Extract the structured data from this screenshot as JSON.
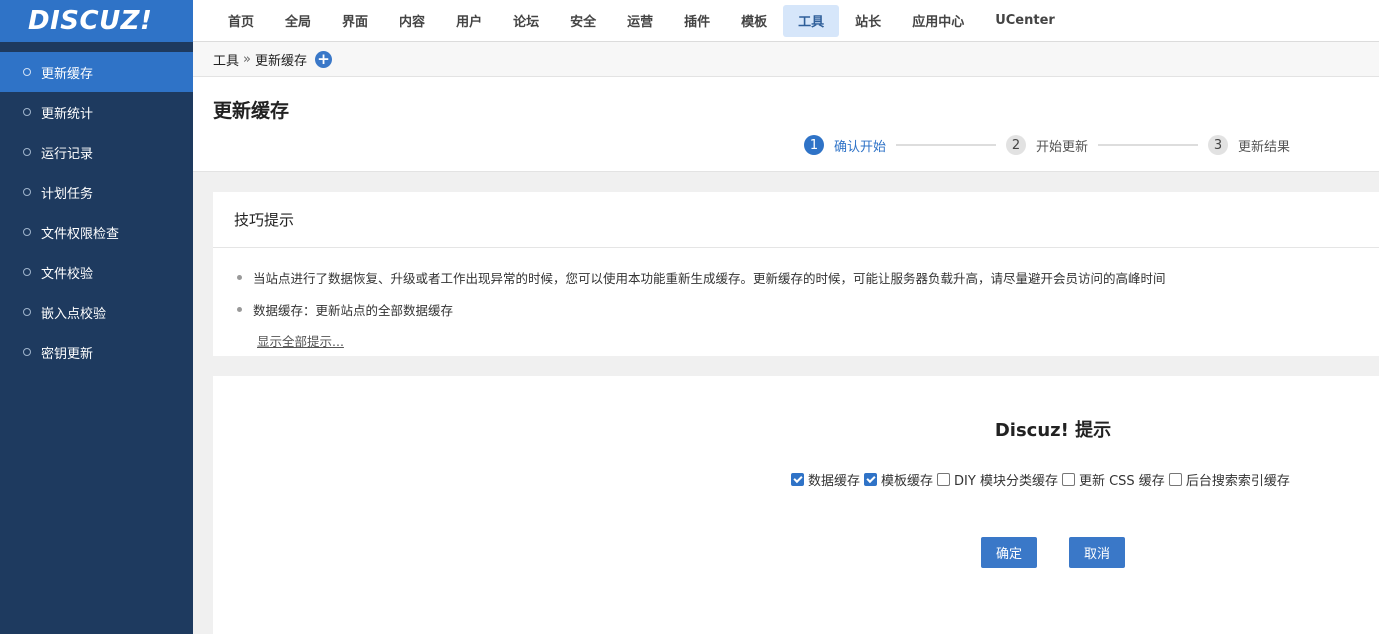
{
  "logo": "DISCUZ!",
  "sidebar": {
    "items": [
      {
        "label": "更新缓存"
      },
      {
        "label": "更新统计"
      },
      {
        "label": "运行记录"
      },
      {
        "label": "计划任务"
      },
      {
        "label": "文件权限检查"
      },
      {
        "label": "文件校验"
      },
      {
        "label": "嵌入点校验"
      },
      {
        "label": "密钥更新"
      }
    ]
  },
  "nav": {
    "items": [
      {
        "label": "首页"
      },
      {
        "label": "全局"
      },
      {
        "label": "界面"
      },
      {
        "label": "内容"
      },
      {
        "label": "用户"
      },
      {
        "label": "论坛"
      },
      {
        "label": "安全"
      },
      {
        "label": "运营"
      },
      {
        "label": "插件"
      },
      {
        "label": "模板"
      },
      {
        "label": "工具"
      },
      {
        "label": "站长"
      },
      {
        "label": "应用中心"
      },
      {
        "label": "UCenter"
      }
    ]
  },
  "breadcrumb": {
    "root": "工具",
    "sep": "»",
    "current": "更新缓存",
    "add_icon": "+"
  },
  "page": {
    "title": "更新缓存"
  },
  "steps": [
    {
      "num": "1",
      "label": "确认开始"
    },
    {
      "num": "2",
      "label": "开始更新"
    },
    {
      "num": "3",
      "label": "更新结果"
    }
  ],
  "tips": {
    "title": "技巧提示",
    "items": [
      "当站点进行了数据恢复、升级或者工作出现异常的时候，您可以使用本功能重新生成缓存。更新缓存的时候，可能让服务器负载升高，请尽量避开会员访问的高峰时间",
      "数据缓存：更新站点的全部数据缓存"
    ],
    "more": "显示全部提示..."
  },
  "panel": {
    "title": "Discuz! 提示",
    "options": [
      {
        "label": "数据缓存",
        "checked": true
      },
      {
        "label": "模板缓存",
        "checked": true
      },
      {
        "label": "DIY 模块分类缓存",
        "checked": false
      },
      {
        "label": "更新 CSS 缓存",
        "checked": false
      },
      {
        "label": "后台搜索索引缓存",
        "checked": false
      }
    ],
    "ok": "确定",
    "cancel": "取消"
  },
  "colors": {
    "accent": "#2f73c7",
    "sidebar": "#1e3a5f"
  }
}
